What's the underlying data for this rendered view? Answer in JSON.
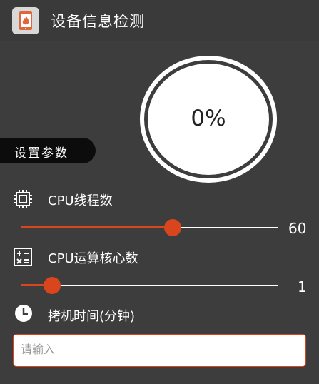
{
  "app": {
    "title": "设备信息检测",
    "icon": "flame-tablet-icon"
  },
  "progress": {
    "value_text": "0%",
    "fraction": 0
  },
  "section": {
    "label": "设置参数"
  },
  "cpu_threads": {
    "icon": "cpu-chip-icon",
    "label": "CPU线程数",
    "value": 60,
    "value_text": "60",
    "fraction": 0.59
  },
  "cpu_cores": {
    "icon": "calculator-icon",
    "label": "CPU运算核心数",
    "value": 1,
    "value_text": "1",
    "fraction": 0.12
  },
  "burn_time": {
    "icon": "clock-icon",
    "label": "拷机时间(分钟)",
    "input_value": "",
    "placeholder": "请输入"
  },
  "colors": {
    "accent": "#d9451c",
    "background": "#3d3d3d",
    "tag_bg": "#0c0c0c"
  }
}
